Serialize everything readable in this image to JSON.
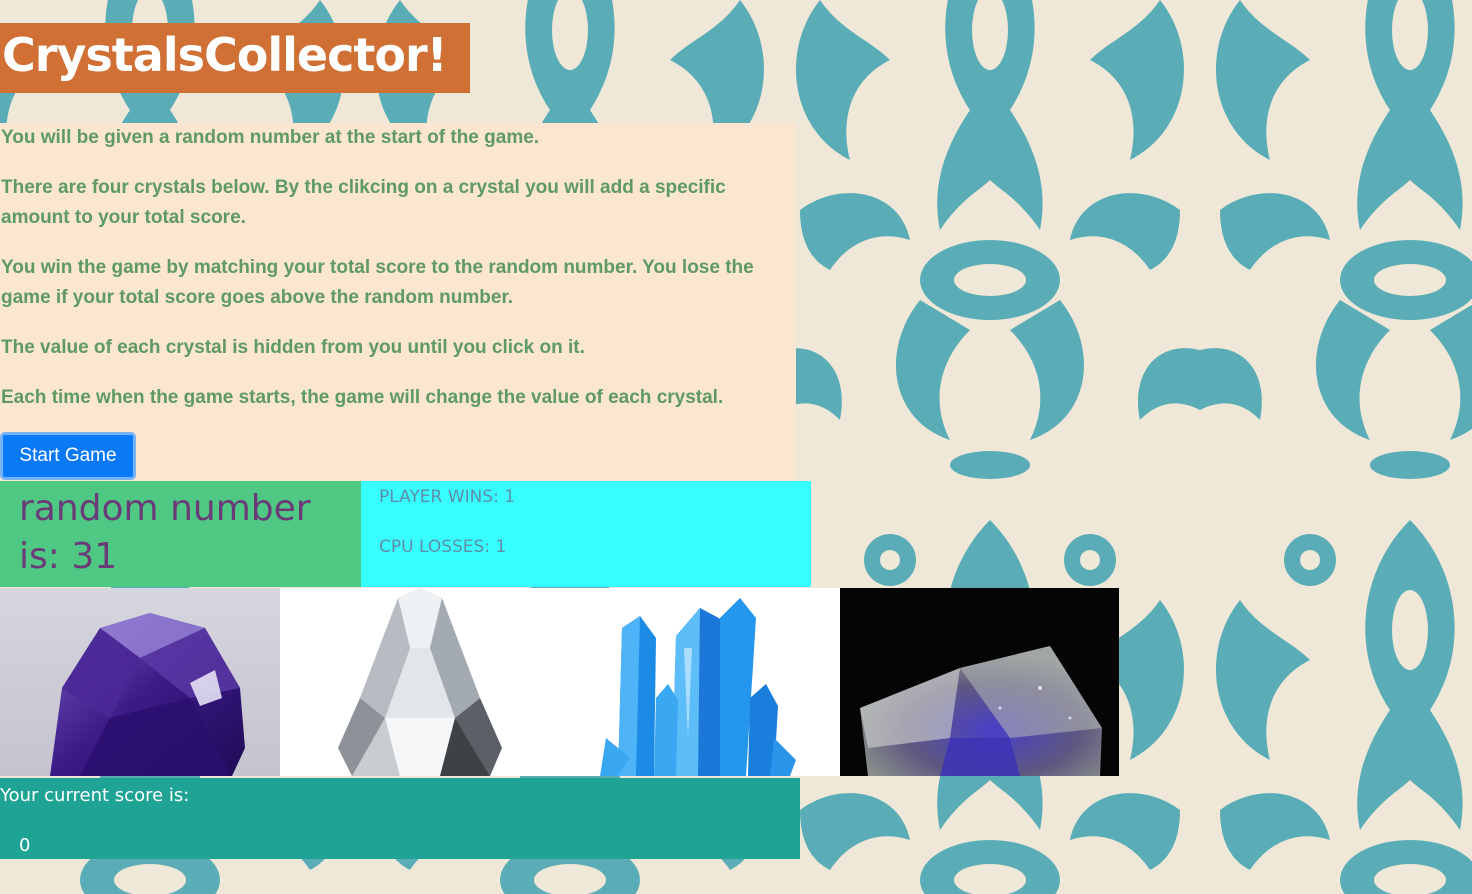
{
  "header": {
    "title": "CrystalsCollector!"
  },
  "instructions": {
    "paragraphs": [
      "You will be given a random number at the start of the game.",
      "There are four crystals below. By the clikcing on a crystal you will add a specific amount to your total score.",
      "You win the game by matching your total score to the random number. You lose the game if your total score goes above the random number.",
      "The value of each crystal is hidden from you until you click on it.",
      "Each time when the game starts, the game will change the value of each crystal."
    ]
  },
  "controls": {
    "start_label": "Start Game"
  },
  "random": {
    "text": "random number is: 31"
  },
  "scoreboard": {
    "wins": "PLAYER WINS: 1",
    "losses": "CPU LOSSES: 1"
  },
  "crystals": [
    {
      "icon": "amethyst-crystal-icon"
    },
    {
      "icon": "clear-faceted-crystal-icon"
    },
    {
      "icon": "blue-quartz-cluster-icon"
    },
    {
      "icon": "fluorite-crystal-icon"
    }
  ],
  "current_score": {
    "label": "Your current score is:",
    "value": "0"
  },
  "colors": {
    "title_bg": "#d07034",
    "instructions_bg": "#fae6d1",
    "instructions_text": "#5e9a62",
    "button_bg": "#0a79f6",
    "random_bg": "#4ec883",
    "random_text": "#6b3a78",
    "scoreboard_bg": "#38ffff",
    "score_bg": "#1fa394",
    "wallpaper_pattern": "#5aadb6",
    "wallpaper_bg": "#efe8d8"
  }
}
